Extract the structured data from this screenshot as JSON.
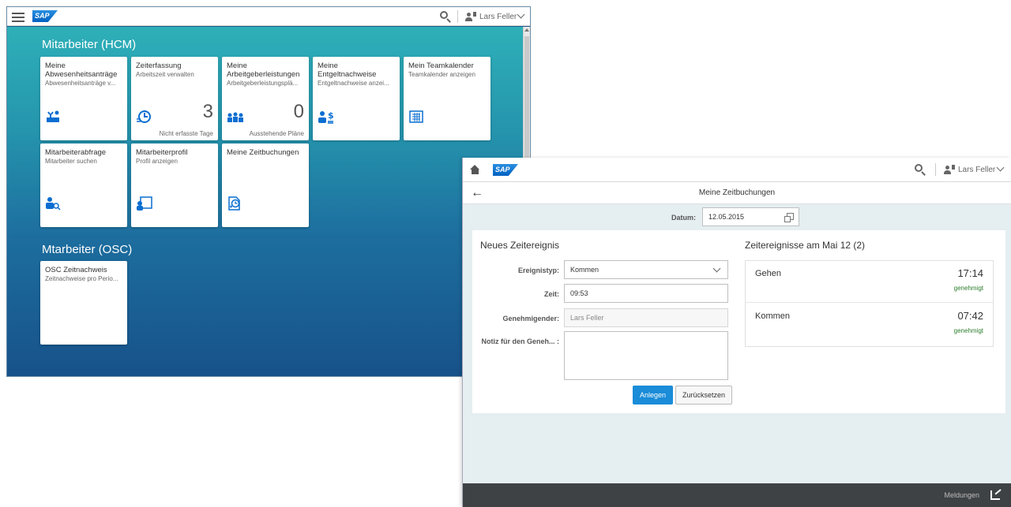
{
  "launchpad": {
    "logo": "SAP",
    "user": "Lars Feller",
    "groups": [
      {
        "title": "Mitarbeiter (HCM)"
      },
      {
        "title": "Mtarbeiter (OSC)"
      }
    ],
    "tiles": [
      {
        "title": "Meine Abwesenheitsanträge",
        "subtitle": "Abwesenheitsanträge v..."
      },
      {
        "title": "Zeiterfassung",
        "subtitle": "Arbeitszeit verwalten",
        "number": "3",
        "footer": "Nicht erfasste Tage"
      },
      {
        "title": "Meine Arbeitgeberleistungen",
        "subtitle": "Arbeitgeberleistungsplä...",
        "number": "0",
        "footer": "Ausstehende Pläne"
      },
      {
        "title": "Meine Entgeltnachweise",
        "subtitle": "Entgeltnachweise anzei..."
      },
      {
        "title": "Mein Teamkalender",
        "subtitle": "Teamkalender anzeigen"
      },
      {
        "title": "Mitarbeiterabfrage",
        "subtitle": "Mitarbeiter suchen"
      },
      {
        "title": "Mitarbeiterprofil",
        "subtitle": "Profil anzeigen"
      },
      {
        "title": "Meine Zeitbuchungen",
        "subtitle": ""
      },
      {
        "title": "OSC Zeitnachweis",
        "subtitle": "Zeitnachweise pro Perio..."
      }
    ]
  },
  "app": {
    "logo": "SAP",
    "user": "Lars Feller",
    "page_title": "Meine Zeitbuchungen",
    "date_label": "Datum:",
    "date_value": "12.05.2015",
    "new_event_title": "Neues Zeitereignis",
    "fields": {
      "type_label": "Ereignistyp:",
      "type_value": "Kommen",
      "time_label": "Zeit:",
      "time_value": "09:53",
      "approver_label": "Genehmigender:",
      "approver_value": "Lars Feller",
      "note_label": "Notiz für den Geneh... :",
      "note_value": ""
    },
    "buttons": {
      "create": "Anlegen",
      "reset": "Zurücksetzen"
    },
    "events_title": "Zeitereignisse am Mai 12 (2)",
    "events": [
      {
        "name": "Gehen",
        "time": "17:14",
        "status": "genehmigt"
      },
      {
        "name": "Kommen",
        "time": "07:42",
        "status": "genehmigt"
      }
    ],
    "footer": {
      "messages": "Meldungen"
    }
  }
}
